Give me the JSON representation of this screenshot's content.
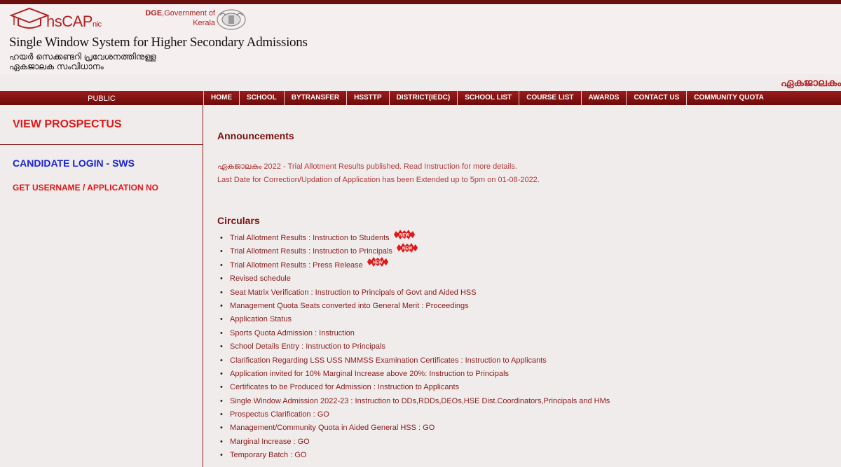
{
  "header": {
    "logo_main": "hsCAP",
    "logo_sub": "nic",
    "gov_line1": "DGE",
    "gov_line1_rest": ",Government of",
    "gov_line2": "Kerala",
    "title": "Single Window System for Higher Secondary Admissions",
    "malayalam_line1": "ഹയർ സെക്കണ്ടറി പ്രവേശനത്തിനുള്ള",
    "malayalam_line2": "ഏകജാലക സംവിധാനം",
    "marquee": "ഏകജാലകം"
  },
  "nav": {
    "public_label": "PUBLIC",
    "items": [
      {
        "label": "HOME"
      },
      {
        "label": "SCHOOL"
      },
      {
        "label": "BYTRANSFER"
      },
      {
        "label": "HSSTTP"
      },
      {
        "label": "DISTRICT(IEDC)"
      },
      {
        "label": "SCHOOL LIST"
      },
      {
        "label": "COURSE LIST"
      },
      {
        "label": "AWARDS"
      },
      {
        "label": "CONTACT US"
      },
      {
        "label": "COMMUNITY QUOTA"
      }
    ]
  },
  "sidebar": {
    "view_prospectus": "VIEW PROSPECTUS",
    "candidate_login": "CANDIDATE LOGIN - SWS",
    "get_username": "GET USERNAME / APPLICATION NO"
  },
  "announcements": {
    "title": "Announcements",
    "lines": [
      "ഏകജാലകം 2022 - Trial Allotment Results published. Read Instruction for more details.",
      "Last Date for Correction/Updation of Application has been Extended up to 5pm on 01-08-2022."
    ]
  },
  "circulars": {
    "title": "Circulars",
    "new_badge_text": "NEW",
    "items": [
      {
        "label": "Trial Allotment Results : Instruction to Students",
        "is_new": true
      },
      {
        "label": "Trial Allotment Results : Instruction to Principals",
        "is_new": true
      },
      {
        "label": "Trial Allotment Results : Press Release",
        "is_new": true
      },
      {
        "label": "Revised schedule",
        "is_new": false
      },
      {
        "label": "Seat Matrix Verification : Instruction to Principals of Govt and Aided HSS",
        "is_new": false
      },
      {
        "label": "Management Quota Seats converted into General Merit : Proceedings",
        "is_new": false
      },
      {
        "label": "Application Status",
        "is_new": false
      },
      {
        "label": "Sports Quota Admission : Instruction",
        "is_new": false
      },
      {
        "label": "School Details Entry : Instruction to Principals",
        "is_new": false
      },
      {
        "label": "Clarification Regarding LSS USS NMMSS Examination Certificates : Instruction to Applicants",
        "is_new": false
      },
      {
        "label": "Application invited for 10% Marginal Increase above 20%: Instruction to Principals",
        "is_new": false
      },
      {
        "label": "Certificates to be Produced for Admission : Instruction to Applicants",
        "is_new": false
      },
      {
        "label": "Single Window Admission 2022-23 : Instruction to DDs,RDDs,DEOs,HSE Dist.Coordinators,Principals and HMs",
        "is_new": false
      },
      {
        "label": "Prospectus Clarification : GO",
        "is_new": false
      },
      {
        "label": "Management/Community Quota in Aided General HSS : GO",
        "is_new": false
      },
      {
        "label": "Marginal Increase : GO",
        "is_new": false
      },
      {
        "label": "Temporary Batch : GO",
        "is_new": false
      }
    ]
  },
  "colors": {
    "nav_bar": "#7d0f0f",
    "accent_red": "#e01818",
    "login_blue": "#1a23d1",
    "link_maroon": "#8b1a1a"
  },
  "icons": {
    "logo": "graduation-cap-logo-icon",
    "emblem": "kerala-emblem-icon",
    "new_badge": "new-badge-icon"
  }
}
